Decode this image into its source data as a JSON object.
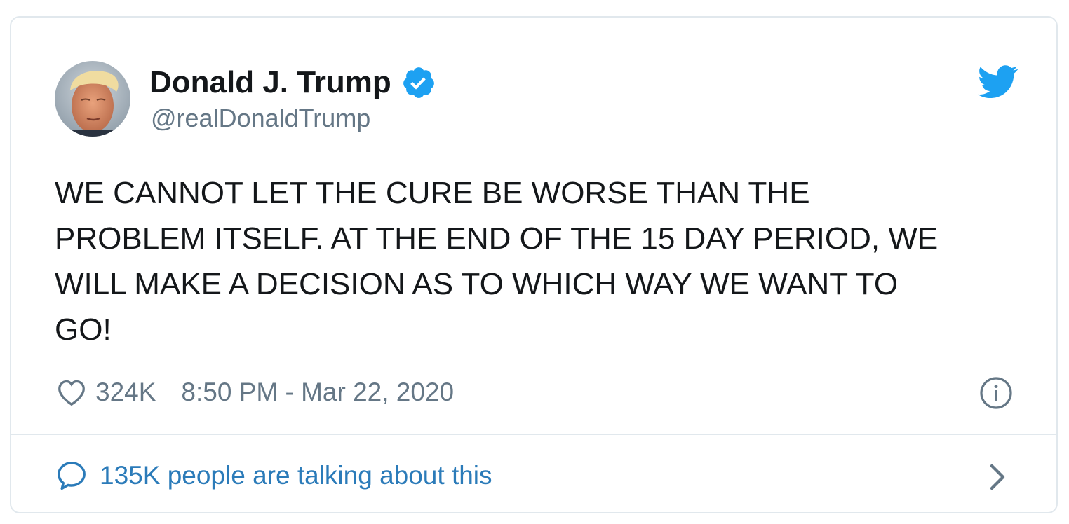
{
  "user": {
    "display_name": "Donald J. Trump",
    "handle": "@realDonaldTrump",
    "verified": true,
    "avatar": "profile-photo"
  },
  "tweet": {
    "text": "WE CANNOT LET THE CURE BE WORSE THAN THE\nPROBLEM ITSELF. AT THE END OF THE 15 DAY PERIOD, WE\nWILL MAKE A DECISION AS TO WHICH WAY WE WANT TO\nGO!",
    "likes": "324K",
    "timestamp": "8:50 PM - Mar 22, 2020"
  },
  "footer": {
    "conversation_label": "135K people are talking about this"
  },
  "icons": {
    "brand": "twitter-bird-icon",
    "verified": "verified-badge-icon",
    "like": "heart-icon",
    "info": "info-icon",
    "reply": "speech-bubble-icon",
    "more": "chevron-right-icon"
  },
  "colors": {
    "brand_blue": "#1da1f2",
    "link_blue": "#2b7bb9",
    "text": "#14171a",
    "muted": "#657786",
    "border": "#e1e8ed"
  }
}
